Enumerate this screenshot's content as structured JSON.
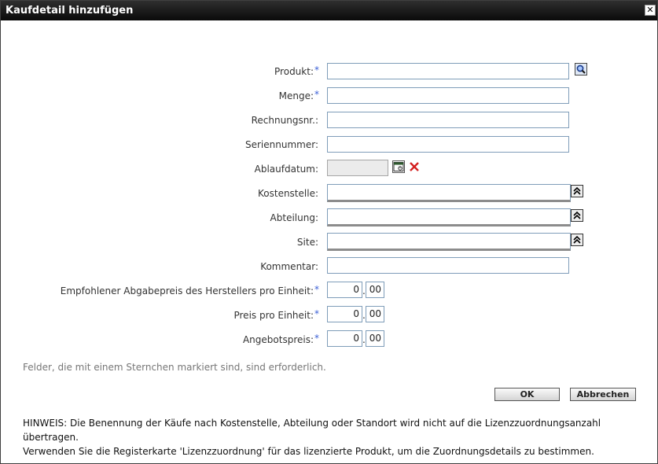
{
  "window": {
    "title": "Kaufdetail hinzufügen",
    "close_label": "✕"
  },
  "required_marker": "*",
  "form": {
    "produkt": {
      "label": "Produkt:",
      "value": ""
    },
    "menge": {
      "label": "Menge:",
      "value": ""
    },
    "rechnungsnr": {
      "label": "Rechnungsnr.:",
      "value": ""
    },
    "seriennummer": {
      "label": "Seriennummer:",
      "value": ""
    },
    "ablaufdatum": {
      "label": "Ablaufdatum:",
      "value": ""
    },
    "kostenstelle": {
      "label": "Kostenstelle:",
      "value": ""
    },
    "abteilung": {
      "label": "Abteilung:",
      "value": ""
    },
    "site": {
      "label": "Site:",
      "value": ""
    },
    "kommentar": {
      "label": "Kommentar:",
      "value": ""
    },
    "herstellerpreis": {
      "label": "Empfohlener Abgabepreis des Herstellers pro Einheit:",
      "whole": "0",
      "decimal": "00"
    },
    "preis_pro_einheit": {
      "label": "Preis pro Einheit:",
      "whole": "0",
      "decimal": "00"
    },
    "angebotspreis": {
      "label": "Angebotspreis:",
      "whole": "0",
      "decimal": "00"
    },
    "decimal_separator": "."
  },
  "required_note": "Felder, die mit einem Sternchen markiert sind, sind erforderlich.",
  "buttons": {
    "ok": "OK",
    "cancel": "Abbrechen"
  },
  "hint": {
    "line1": "HINWEIS: Die Benennung der Käufe nach Kostenstelle, Abteilung oder Standort wird nicht auf die Lizenzzuordnungsanzahl übertragen.",
    "line2": "Verwenden Sie die Registerkarte 'Lizenzzuordnung' für das lizenzierte Produkt, um die Zuordnungsdetails zu bestimmen."
  }
}
